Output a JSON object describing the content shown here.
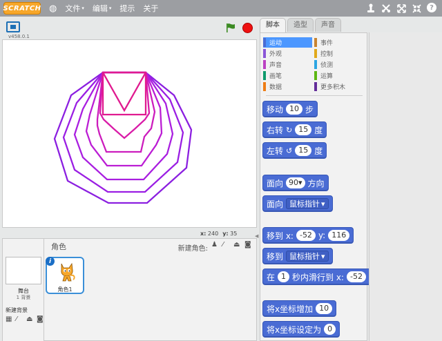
{
  "app": {
    "logo": "SCRATCH"
  },
  "menu": {
    "items": [
      {
        "label": "文件",
        "caret": "▾"
      },
      {
        "label": "编辑",
        "caret": "▾"
      },
      {
        "label": "提示",
        "caret": ""
      },
      {
        "label": "关于",
        "caret": ""
      }
    ]
  },
  "toolbar": {
    "icons": [
      "duplicate-icon",
      "delete-icon",
      "grow-icon",
      "shrink-icon",
      "help-icon"
    ],
    "help_label": "?"
  },
  "stage": {
    "version": "v458.0.1",
    "mouse_x_label": "x:",
    "mouse_x": "240",
    "mouse_y_label": "y:",
    "mouse_y": "35"
  },
  "sprites": {
    "title": "角色",
    "new_sprite_label": "新建角色:",
    "stage_label": "舞台",
    "stage_backdrops": "1 背景",
    "new_backdrop_label": "新建背景",
    "items": [
      {
        "name": "角色1"
      }
    ]
  },
  "tabs": [
    {
      "label": "脚本",
      "active": true
    },
    {
      "label": "造型",
      "active": false
    },
    {
      "label": "声音",
      "active": false
    }
  ],
  "categories": [
    {
      "label": "运动",
      "color": "#4a6cd4",
      "active": true
    },
    {
      "label": "事件",
      "color": "#c88330",
      "active": false
    },
    {
      "label": "外观",
      "color": "#8a55d7",
      "active": false
    },
    {
      "label": "控制",
      "color": "#e1a91a",
      "active": false
    },
    {
      "label": "声音",
      "color": "#bb42c3",
      "active": false
    },
    {
      "label": "侦测",
      "color": "#2ca5e2",
      "active": false
    },
    {
      "label": "画笔",
      "color": "#0e9a6c",
      "active": false
    },
    {
      "label": "运算",
      "color": "#5cb712",
      "active": false
    },
    {
      "label": "数据",
      "color": "#ee7d16",
      "active": false
    },
    {
      "label": "更多积木",
      "color": "#632d99",
      "active": false
    }
  ],
  "blocks": {
    "move": {
      "pre": "移动",
      "value": "10",
      "post": "步"
    },
    "turn_right": {
      "pre": "右转",
      "icon": "↻",
      "value": "15",
      "post": "度"
    },
    "turn_left": {
      "pre": "左转",
      "icon": "↺",
      "value": "15",
      "post": "度"
    },
    "point_dir": {
      "pre": "面向",
      "value": "90",
      "caret": "▾",
      "post": "方向"
    },
    "point_towards": {
      "pre": "面向",
      "value": "鼠标指针",
      "caret": "▾"
    },
    "go_to_xy": {
      "pre": "移到 x:",
      "x": "-52",
      "mid": "y:",
      "y": "116"
    },
    "go_to": {
      "pre": "移到",
      "value": "鼠标指针",
      "caret": "▾"
    },
    "glide": {
      "pre": "在",
      "value": "1",
      "mid": "秒内滑行到 x:",
      "x": "-52"
    },
    "change_x": {
      "pre": "将x坐标增加",
      "value": "10"
    },
    "set_x": {
      "pre": "将x坐标设定为",
      "value": "0"
    }
  },
  "colors": {
    "motion": "#4a6cd4",
    "stop": "#ee1111",
    "flag": "#3b8a22",
    "selection": "#3a8fd8"
  }
}
